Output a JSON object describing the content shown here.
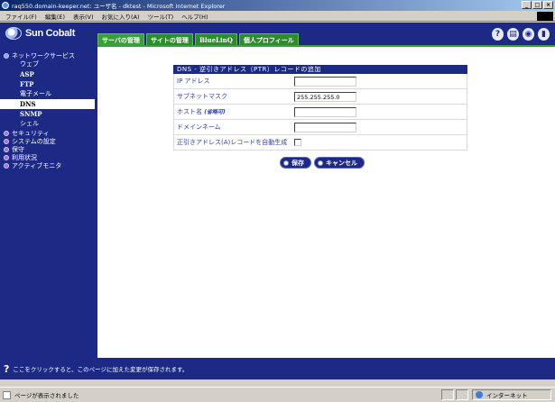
{
  "window": {
    "title": "raq550.domain-keeper.net: ユーザ名 - dktest - Microsoft Internet Explorer",
    "controls": [
      "_",
      "□",
      "×"
    ]
  },
  "menu": [
    "ファイル(F)",
    "編集(E)",
    "表示(V)",
    "お気に入り(A)",
    "ツール(T)",
    "ヘルプ(H)"
  ],
  "header": {
    "logo": "Sun Cobalt",
    "tabs": [
      "サーバの管理",
      "サイトの管理",
      "BlueLinQ",
      "個人プロフィール"
    ],
    "icons": [
      "help-icon",
      "console-icon",
      "eye-icon",
      "logout-icon"
    ]
  },
  "sidebar": {
    "network": "ネットワークサービス",
    "subitems": [
      "ウェブ",
      "ASP",
      "FTP",
      "電子メール",
      "DNS",
      "SNMP",
      "シェル"
    ],
    "sections": [
      "セキュリティ",
      "システムの設定",
      "保守",
      "利用状況",
      "アクティブモニタ"
    ]
  },
  "form": {
    "title": "DNS - 逆引きアドレス（PTR）レコードの追加",
    "ip_label": "IP アドレス",
    "ip_value": "",
    "mask_label": "サブネットマスク",
    "mask_value": "255.255.255.0",
    "host_label": "ホスト名",
    "host_hint": "(省略可)",
    "host_value": "",
    "domain_label": "ドメインネーム",
    "domain_value": "",
    "auto_label": "正引きアドレス(A)レコードを自動生成",
    "save": "保存",
    "cancel": "キャンセル"
  },
  "hintbar": {
    "text": "ここをクリックすると、このページに加えた変更が保存されます。"
  },
  "status": {
    "text": "ページが表示されました",
    "zone": "インターネット"
  },
  "colors": {
    "navy": "#1c2a86",
    "tab_green": "#2e8b2e",
    "label_blue": "#3040a8"
  }
}
